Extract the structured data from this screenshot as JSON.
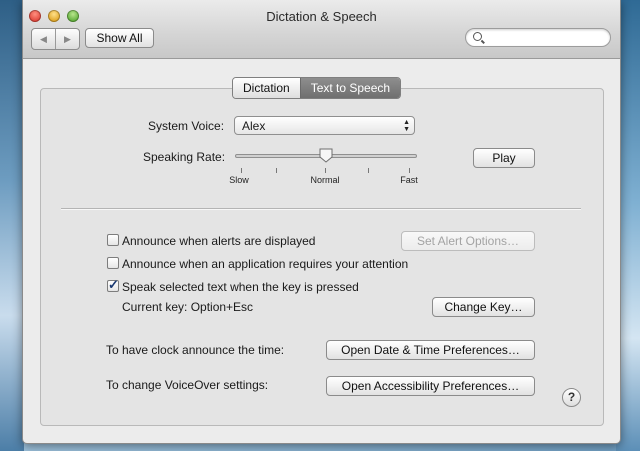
{
  "window": {
    "title": "Dictation & Speech",
    "toolbar": {
      "back_glyph": "◀",
      "forward_glyph": "▶",
      "show_all_label": "Show All",
      "search": {
        "value": "",
        "placeholder": ""
      }
    }
  },
  "tabs": [
    {
      "label": "Dictation",
      "selected": false
    },
    {
      "label": "Text to Speech",
      "selected": true
    }
  ],
  "voice": {
    "system_voice_label": "System Voice:",
    "system_voice_value": "Alex",
    "speaking_rate_label": "Speaking Rate:",
    "rate_level": 0.5,
    "rate_ticks": {
      "slow": "Slow",
      "normal": "Normal",
      "fast": "Fast"
    },
    "play_label": "Play"
  },
  "options": {
    "announce_alerts": {
      "label": "Announce when alerts are displayed",
      "checked": false
    },
    "set_alert_options_label": "Set Alert Options…",
    "announce_app_attention": {
      "label": "Announce when an application requires your attention",
      "checked": false
    },
    "speak_selected": {
      "label": "Speak selected text when the key is pressed",
      "checked": true
    },
    "current_key_label": "Current key: Option+Esc",
    "change_key_label": "Change Key…"
  },
  "links": {
    "clock_label": "To have clock announce the time:",
    "clock_button": "Open Date & Time Preferences…",
    "voiceover_label": "To change VoiceOver settings:",
    "voiceover_button": "Open Accessibility Preferences…"
  },
  "help_glyph": "?",
  "icons": [
    "close-icon",
    "minimize-icon",
    "zoom-icon",
    "back-arrow-icon",
    "forward-arrow-icon",
    "search-icon",
    "help-icon",
    "popup-arrows-icon",
    "checkmark-icon"
  ]
}
